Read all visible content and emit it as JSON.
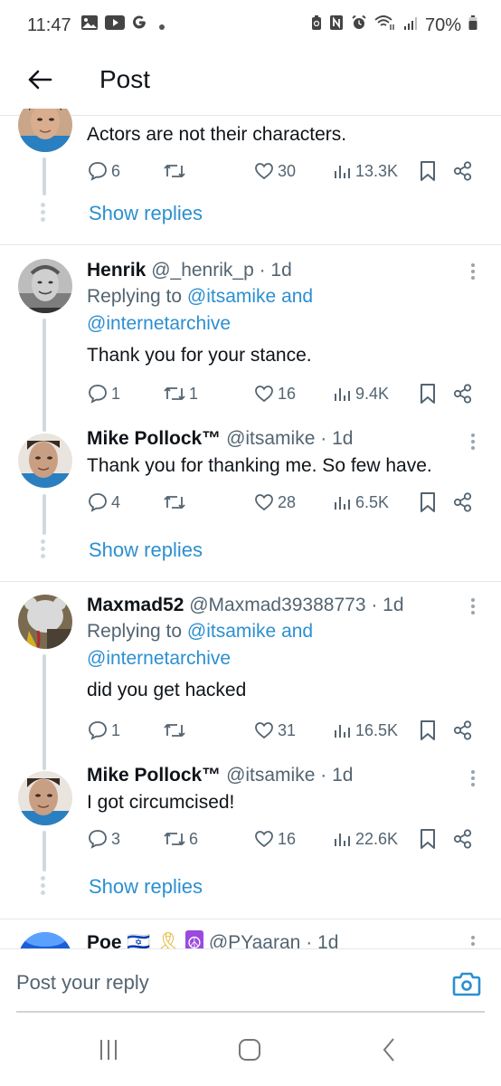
{
  "status_bar": {
    "time": "11:47",
    "left_icons": [
      "gallery-icon",
      "youtube-icon",
      "google-icon",
      "dot-icon"
    ],
    "right_icons": [
      "battery-saver-icon",
      "nfc-icon",
      "alarm-icon",
      "wifi-icon",
      "signal-icon"
    ],
    "battery_percent": "70%"
  },
  "header": {
    "back_icon": "arrow-left-icon",
    "title": "Post"
  },
  "tweets": [
    {
      "name": "",
      "handle": "",
      "time": "",
      "text": "Actors are not their characters.",
      "actions": {
        "replies": "6",
        "reposts": "",
        "likes": "30",
        "views": "13.3K"
      },
      "show_replies": "Show replies"
    },
    {
      "name": "Henrik",
      "handle": "@_henrik_p",
      "time": "· 1d",
      "replying_prefix": "Replying to ",
      "replying_to": "@itsamike and @internetarchive",
      "text": "Thank you for your stance.",
      "actions": {
        "replies": "1",
        "reposts": "1",
        "likes": "16",
        "views": "9.4K"
      }
    },
    {
      "name": "Mike Pollock™",
      "handle": "@itsamike",
      "time": "· 1d",
      "text": "Thank you for thanking me. So few have.",
      "actions": {
        "replies": "4",
        "reposts": "",
        "likes": "28",
        "views": "6.5K"
      },
      "show_replies": "Show replies"
    },
    {
      "name": "Maxmad52",
      "handle": "@Maxmad39388773",
      "time": "· 1d",
      "replying_prefix": "Replying to ",
      "replying_to": "@itsamike and @internetarchive",
      "text": "did you get hacked",
      "actions": {
        "replies": "1",
        "reposts": "",
        "likes": "31",
        "views": "16.5K"
      }
    },
    {
      "name": "Mike Pollock™",
      "handle": "@itsamike",
      "time": "· 1d",
      "text": "I got circumcised!",
      "actions": {
        "replies": "3",
        "reposts": "6",
        "likes": "16",
        "views": "22.6K"
      },
      "show_replies": "Show replies"
    },
    {
      "name": "Poe",
      "badges": [
        "🇮🇱",
        "🎗",
        "☮"
      ],
      "handle": "@PYaaran",
      "time": "· 1d"
    }
  ],
  "composer": {
    "placeholder": "Post your reply",
    "value": "",
    "camera_icon": "camera-icon"
  },
  "nav_bar": {
    "buttons": [
      "recent-apps-icon",
      "home-icon",
      "back-icon"
    ]
  },
  "colors": {
    "accent": "#2c8fd0",
    "text_primary": "#0f1419",
    "text_secondary": "#536471",
    "thread_line": "#cfd9de"
  }
}
